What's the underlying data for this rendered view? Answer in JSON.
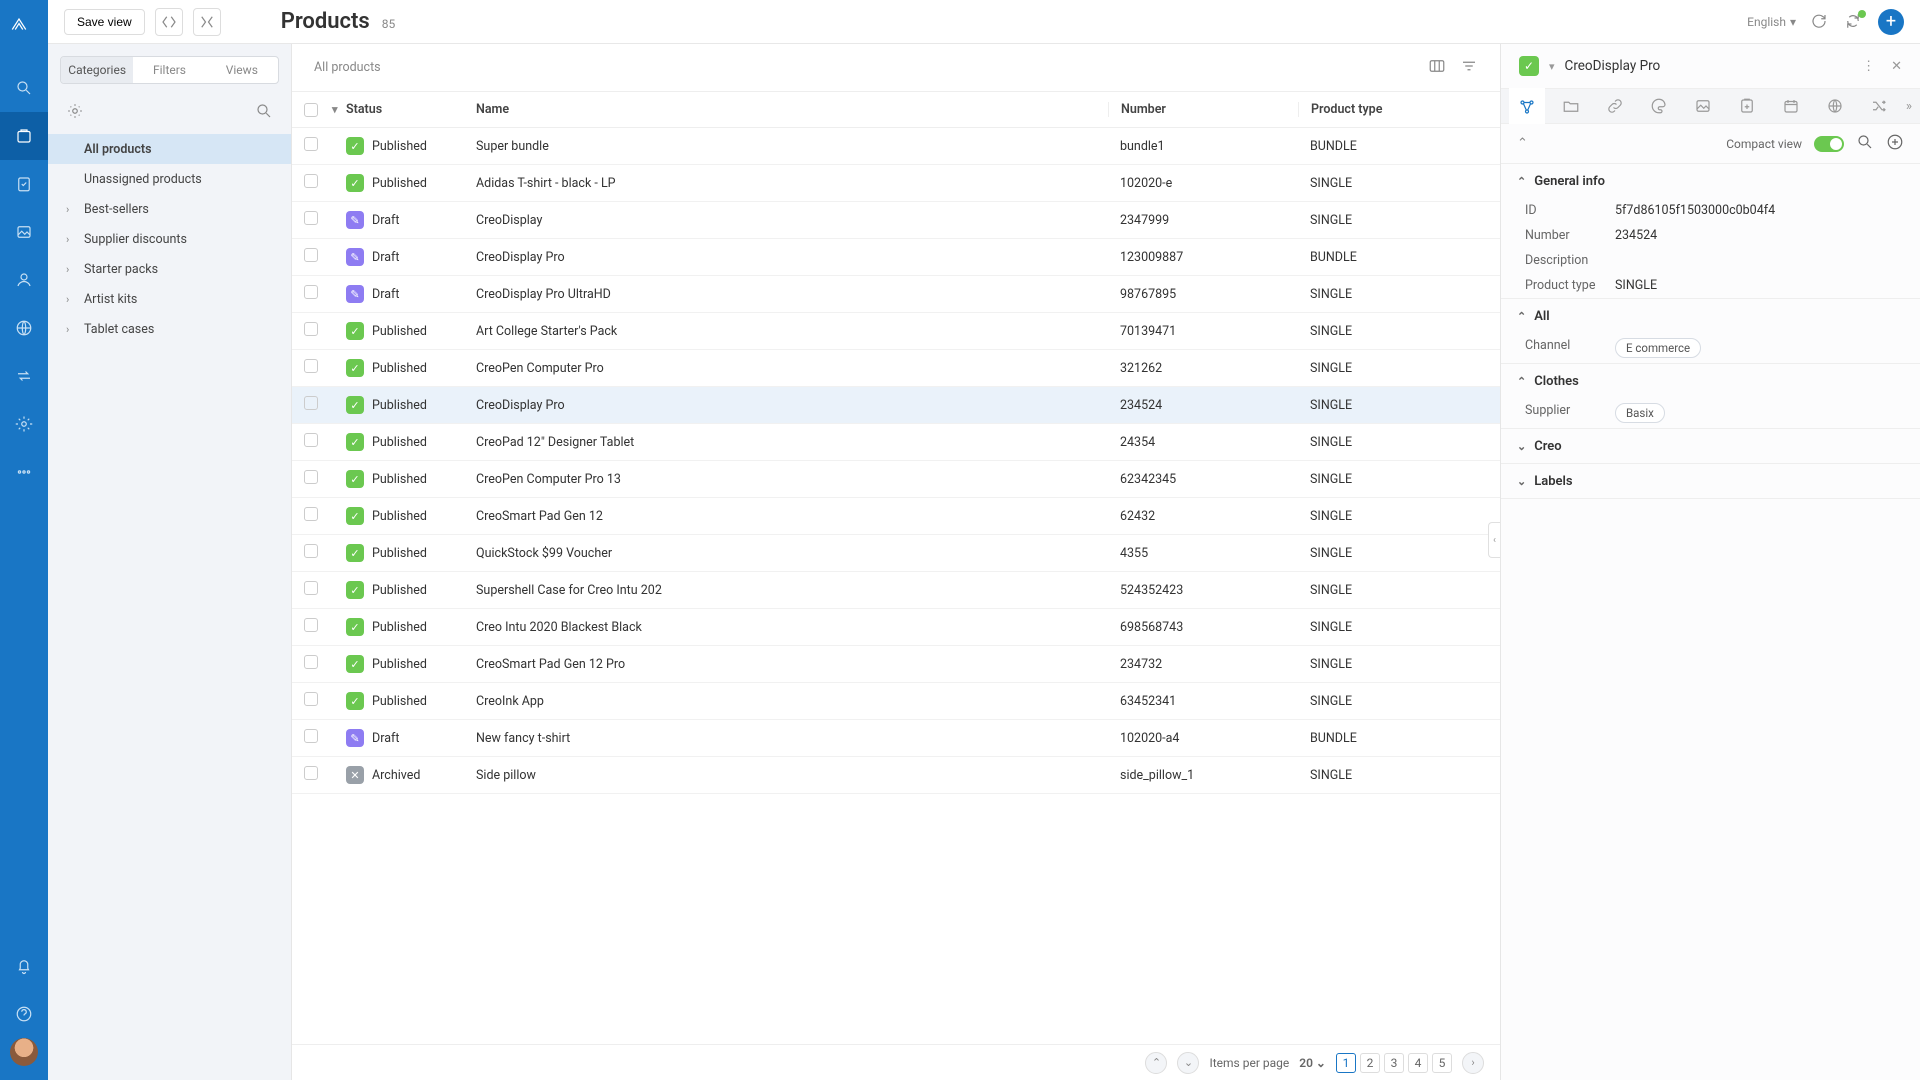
{
  "header": {
    "save_view": "Save view",
    "title": "Products",
    "count": "85",
    "language": "English"
  },
  "catpanel": {
    "tabs": [
      "Categories",
      "Filters",
      "Views"
    ],
    "active_tab": 0,
    "items": [
      {
        "label": "All products",
        "expandable": false,
        "selected": true
      },
      {
        "label": "Unassigned products",
        "expandable": false
      },
      {
        "label": "Best-sellers",
        "expandable": true
      },
      {
        "label": "Supplier discounts",
        "expandable": true
      },
      {
        "label": "Starter packs",
        "expandable": true
      },
      {
        "label": "Artist kits",
        "expandable": true
      },
      {
        "label": "Tablet cases",
        "expandable": true
      }
    ]
  },
  "toolbar": {
    "breadcrumb": "All products"
  },
  "columns": {
    "status": "Status",
    "name": "Name",
    "number": "Number",
    "type": "Product type"
  },
  "rows": [
    {
      "status": "Published",
      "name": "Super bundle",
      "number": "bundle1",
      "type": "BUNDLE"
    },
    {
      "status": "Published",
      "name": "Adidas T-shirt - black - LP",
      "number": "102020-e",
      "type": "SINGLE"
    },
    {
      "status": "Draft",
      "name": "CreoDisplay",
      "number": "2347999",
      "type": "SINGLE"
    },
    {
      "status": "Draft",
      "name": "CreoDisplay Pro",
      "number": "123009887",
      "type": "BUNDLE"
    },
    {
      "status": "Draft",
      "name": "CreoDisplay Pro UltraHD",
      "number": "98767895",
      "type": "SINGLE"
    },
    {
      "status": "Published",
      "name": "Art College Starter's Pack",
      "number": "70139471",
      "type": "SINGLE"
    },
    {
      "status": "Published",
      "name": "CreoPen Computer Pro",
      "number": "321262",
      "type": "SINGLE"
    },
    {
      "status": "Published",
      "name": "CreoDisplay Pro",
      "number": "234524",
      "type": "SINGLE",
      "selected": true
    },
    {
      "status": "Published",
      "name": "CreoPad 12\" Designer Tablet",
      "number": "24354",
      "type": "SINGLE"
    },
    {
      "status": "Published",
      "name": "CreoPen Computer Pro 13",
      "number": "62342345",
      "type": "SINGLE"
    },
    {
      "status": "Published",
      "name": "CreoSmart Pad Gen 12",
      "number": "62432",
      "type": "SINGLE"
    },
    {
      "status": "Published",
      "name": "QuickStock $99 Voucher",
      "number": "4355",
      "type": "SINGLE"
    },
    {
      "status": "Published",
      "name": "Supershell Case for Creo Intu 202",
      "number": "524352423",
      "type": "SINGLE"
    },
    {
      "status": "Published",
      "name": "Creo Intu 2020 Blackest Black",
      "number": "698568743",
      "type": "SINGLE"
    },
    {
      "status": "Published",
      "name": "CreoSmart Pad Gen 12 Pro",
      "number": "234732",
      "type": "SINGLE"
    },
    {
      "status": "Published",
      "name": "CreoInk App",
      "number": "63452341",
      "type": "SINGLE"
    },
    {
      "status": "Draft",
      "name": "New fancy t-shirt",
      "number": "102020-a4",
      "type": "BUNDLE"
    },
    {
      "status": "Archived",
      "name": "Side pillow",
      "number": "side_pillow_1",
      "type": "SINGLE"
    }
  ],
  "pager": {
    "items_per_page_label": "Items per page",
    "items_per_page": "20",
    "pages": [
      "1",
      "2",
      "3",
      "4",
      "5"
    ],
    "current": "1"
  },
  "detail": {
    "title": "CreoDisplay Pro",
    "compact_label": "Compact view",
    "sections": {
      "general": {
        "title": "General info",
        "open": true,
        "id_k": "ID",
        "id_v": "5f7d86105f1503000c0b04f4",
        "number_k": "Number",
        "number_v": "234524",
        "desc_k": "Description",
        "desc_v": "",
        "type_k": "Product type",
        "type_v": "SINGLE"
      },
      "all": {
        "title": "All",
        "open": true,
        "channel_k": "Channel",
        "channel_v": "E commerce"
      },
      "clothes": {
        "title": "Clothes",
        "open": true,
        "supplier_k": "Supplier",
        "supplier_v": "Basix"
      },
      "creo": {
        "title": "Creo",
        "open": false
      },
      "labels": {
        "title": "Labels",
        "open": false
      }
    }
  }
}
